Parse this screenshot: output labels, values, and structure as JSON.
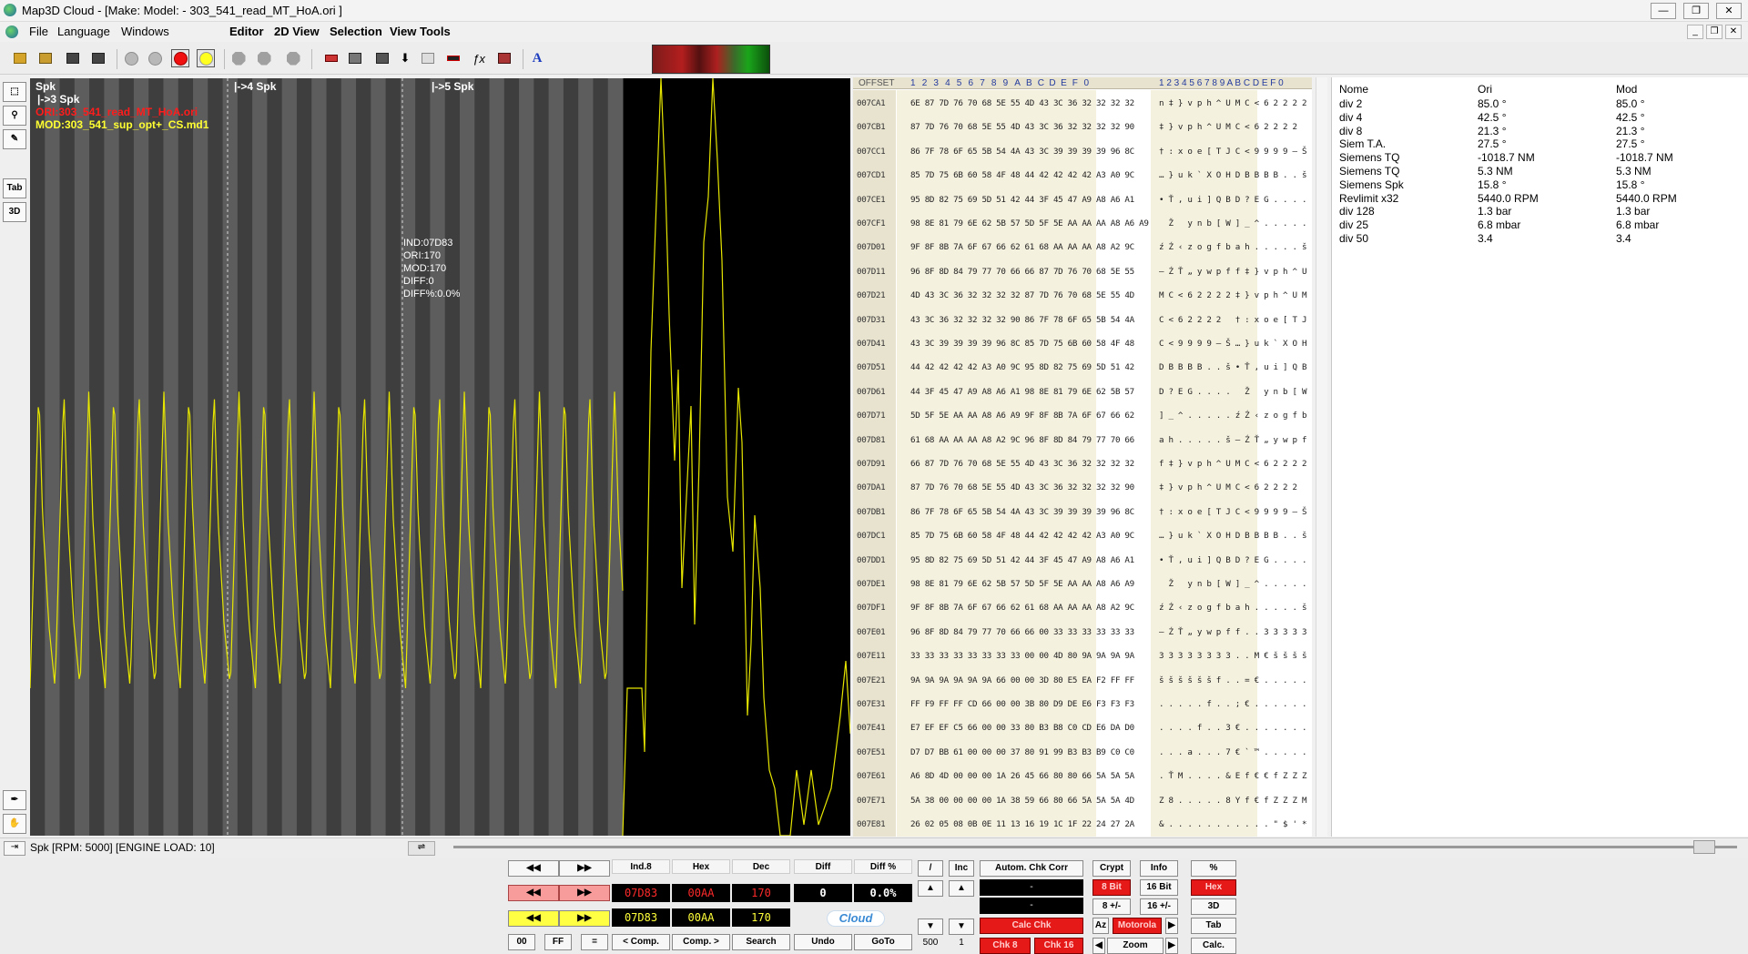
{
  "window": {
    "title": "Map3D Cloud - [Make:  Model:   - 303_541_read_MT_HoA.ori ]",
    "min_label": "—",
    "max_label": "❐",
    "close_label": "✕"
  },
  "menu": {
    "file": "File",
    "language": "Language",
    "windows": "Windows",
    "editor": "Editor",
    "view2d": "2D View",
    "selection": "Selection",
    "viewtools": "View Tools"
  },
  "leftbar": {
    "tab": "Tab",
    "three_d": "3D"
  },
  "graph": {
    "sections": [
      "Spk",
      "|->4 Spk",
      "|->5 Spk"
    ],
    "sub_section": "|->3 Spk",
    "ori_file": "ORI:303_541_read_MT_HoA.ori",
    "mod_file": "MOD:303_541_sup_opt+_CS.md1",
    "tooltip": [
      "IND:07D83",
      "ORI:170",
      "MOD:170",
      "DIFF:0",
      "DIFF%:0.0%"
    ]
  },
  "hex": {
    "offset_label": "OFFSET",
    "col_heads": [
      "1",
      "2",
      "3",
      "4",
      "5",
      "6",
      "7",
      "8",
      "9",
      "A",
      "B",
      "C",
      "D",
      "E",
      "F",
      "0"
    ],
    "ascii_head": "1 2 3 4 5 6 7 8 9 A B C D E F 0",
    "rows": [
      {
        "o": "007CA1",
        "h": "6E 87 7D 76 70 68 5E 55 4D 43 3C 36 32 32 32 32",
        "a": "n ‡ } v p h ^ U M C < 6 2 2 2 2"
      },
      {
        "o": "007CB1",
        "h": "87 7D 76 70 68 5E 55 4D 43 3C 36 32 32 32 32 90",
        "a": "‡ } v p h ^ U M C < 6 2 2 2 2"
      },
      {
        "o": "007CC1",
        "h": "86 7F 78 6F 65 5B 54 4A 43 3C 39 39 39 39 96 8C",
        "a": "† : x o e [ T J C < 9 9 9 9 – Š"
      },
      {
        "o": "007CD1",
        "h": "85 7D 75 6B 60 58 4F 48 44 42 42 42 42 A3 A0 9C",
        "a": "… } u k ` X O H D B B B B . . š"
      },
      {
        "o": "007CE1",
        "h": "95 8D 82 75 69 5D 51 42 44 3F 45 47 A9 A8 A6 A1",
        "a": "• Ť , u i ] Q B D ? E G . . . ."
      },
      {
        "o": "007CF1",
        "h": "98 8E 81 79 6E 62 5B 57 5D 5F 5E AA AA AA A8 A6 A9",
        "a": "  Ž   y n b [ W ] _ ^ . . . . ."
      },
      {
        "o": "007D01",
        "h": "9F 8F 8B 7A 6F 67 66 62 61 68 AA AA AA A8 A2 9C",
        "a": "ź Ź ‹ z o g f b a h . . . . . š"
      },
      {
        "o": "007D11",
        "h": "96 8F 8D 84 79 77 70 66 66 87 7D 76 70 68 5E 55",
        "a": "– Ź Ť „ y w p f f ‡ } v p h ^ U"
      },
      {
        "o": "007D21",
        "h": "4D 43 3C 36 32 32 32 32 87 7D 76 70 68 5E 55 4D",
        "a": "M C < 6 2 2 2 2 ‡ } v p h ^ U M"
      },
      {
        "o": "007D31",
        "h": "43 3C 36 32 32 32 32 90 86 7F 78 6F 65 5B 54 4A",
        "a": "C < 6 2 2 2 2   † : x o e [ T J"
      },
      {
        "o": "007D41",
        "h": "43 3C 39 39 39 39 96 8C 85 7D 75 6B 60 58 4F 48",
        "a": "C < 9 9 9 9 – Š … } u k ` X O H"
      },
      {
        "o": "007D51",
        "h": "44 42 42 42 42 A3 A0 9C 95 8D 82 75 69 5D 51 42",
        "a": "D B B B B . . š • Ť , u i ] Q B"
      },
      {
        "o": "007D61",
        "h": "44 3F 45 47 A9 A8 A6 A1 98 8E 81 79 6E 62 5B 57",
        "a": "D ? E G . . . .   Ž   y n b [ W"
      },
      {
        "o": "007D71",
        "h": "5D 5F 5E AA AA A8 A6 A9 9F 8F 8B 7A 6F 67 66 62",
        "a": "] _ ^ . . . . . ź Ź ‹ z o g f b"
      },
      {
        "o": "007D81",
        "h": "61 68 AA AA AA A8 A2 9C 96 8F 8D 84 79 77 70 66",
        "a": "a h . . . . . š – Ź Ť „ y w p f"
      },
      {
        "o": "007D91",
        "h": "66 87 7D 76 70 68 5E 55 4D 43 3C 36 32 32 32 32",
        "a": "f ‡ } v p h ^ U M C < 6 2 2 2 2"
      },
      {
        "o": "007DA1",
        "h": "87 7D 76 70 68 5E 55 4D 43 3C 36 32 32 32 32 90",
        "a": "‡ } v p h ^ U M C < 6 2 2 2 2"
      },
      {
        "o": "007DB1",
        "h": "86 7F 78 6F 65 5B 54 4A 43 3C 39 39 39 39 96 8C",
        "a": "† : x o e [ T J C < 9 9 9 9 – Š"
      },
      {
        "o": "007DC1",
        "h": "85 7D 75 6B 60 58 4F 48 44 42 42 42 42 A3 A0 9C",
        "a": "… } u k ` X O H D B B B B . . š"
      },
      {
        "o": "007DD1",
        "h": "95 8D 82 75 69 5D 51 42 44 3F 45 47 A9 A8 A6 A1",
        "a": "• Ť , u i ] Q B D ? E G . . . ."
      },
      {
        "o": "007DE1",
        "h": "98 8E 81 79 6E 62 5B 57 5D 5F 5E AA AA A8 A6 A9",
        "a": "  Ž   y n b [ W ] _ ^ . . . . ."
      },
      {
        "o": "007DF1",
        "h": "9F 8F 8B 7A 6F 67 66 62 61 68 AA AA AA A8 A2 9C",
        "a": "ź Ź ‹ z o g f b a h . . . . . š"
      },
      {
        "o": "007E01",
        "h": "96 8F 8D 84 79 77 70 66 66 00 33 33 33 33 33 33",
        "a": "– Ź Ť „ y w p f f . . 3 3 3 3 3"
      },
      {
        "o": "007E11",
        "h": "33 33 33 33 33 33 33 33 00 00 4D 80 9A 9A 9A 9A",
        "a": "3 3 3 3 3 3 3 3 . . M € š š š š"
      },
      {
        "o": "007E21",
        "h": "9A 9A 9A 9A 9A 9A 66 00 00 3D 80 E5 EA F2 FF FF",
        "a": "š š š š š š f . . = € . . . . ."
      },
      {
        "o": "007E31",
        "h": "FF F9 FF FF CD 66 00 00 3B 80 D9 DE E6 F3 F3 F3",
        "a": ". . . . . f . . ; € . . . . . ."
      },
      {
        "o": "007E41",
        "h": "E7 EF EF C5 66 00 00 33 80 B3 B8 C0 CD E6 DA D0",
        "a": ". . . . f . . 3 € . . . . . . ."
      },
      {
        "o": "007E51",
        "h": "D7 D7 BB 61 00 00 00 37 80 91 99 B3 B3 B9 C0 C0",
        "a": ". . . a . . . 7 € ` ™ . . . . ."
      },
      {
        "o": "007E61",
        "h": "A6 8D 4D 00 00 00 1A 26 45 66 80 80 66 5A 5A 5A",
        "a": ". Ť M . . . . & E f € € f Z Z Z"
      },
      {
        "o": "007E71",
        "h": "5A 38 00 00 00 00 1A 38 59 66 80 66 5A 5A 5A 4D",
        "a": "Z 8 . . . . . 8 Y f € f Z Z Z M"
      },
      {
        "o": "007E81",
        "h": "26 02 05 08 0B 0E 11 13 16 19 1C 1F 22 24 27 2A",
        "a": "& . . . . . . . . . . . \" $ ' *"
      }
    ]
  },
  "side": {
    "headers": {
      "name": "Nome",
      "ori": "Ori",
      "mod": "Mod"
    },
    "rows": [
      {
        "name": "div 2",
        "ori": "85.0 °",
        "mod": "85.0 °"
      },
      {
        "name": "div 4",
        "ori": "42.5 °",
        "mod": "42.5 °"
      },
      {
        "name": "div 8",
        "ori": "21.3 °",
        "mod": "21.3 °"
      },
      {
        "name": "Siem T.A.",
        "ori": "27.5 °",
        "mod": "27.5 °"
      },
      {
        "name": "Siemens TQ",
        "ori": "-1018.7 NM",
        "mod": "-1018.7 NM"
      },
      {
        "name": "Siemens TQ",
        "ori": "5.3 NM",
        "mod": "5.3 NM"
      },
      {
        "name": "Siemens Spk",
        "ori": "15.8 °",
        "mod": "15.8 °"
      },
      {
        "name": "Revlimit x32",
        "ori": "5440.0 RPM",
        "mod": "5440.0 RPM"
      },
      {
        "name": "div 128",
        "ori": "1.3 bar",
        "mod": "1.3 bar"
      },
      {
        "name": "div 25",
        "ori": "6.8 mbar",
        "mod": "6.8 mbar"
      },
      {
        "name": "div 50",
        "ori": "3.4",
        "mod": "3.4"
      }
    ]
  },
  "status": {
    "text": "Spk [RPM: 5000] [ENGINE LOAD: 10]"
  },
  "bottom": {
    "heads": {
      "ind": "Ind.8",
      "hex": "Hex",
      "dec": "Dec",
      "diff": "Diff",
      "diffp": "Diff %"
    },
    "red_row": {
      "ind": "07D83",
      "hex": "00AA",
      "dec": "170",
      "diff": "0",
      "diffp": "0.0%"
    },
    "yel_row": {
      "ind": "07D83",
      "hex": "00AA",
      "dec": "170"
    },
    "cloud": "Cloud",
    "btn_00": "00",
    "btn_ff": "FF",
    "btn_eq": "=",
    "btn_comp_l": "< Comp.",
    "btn_comp_r": "Comp. >",
    "btn_search": "Search",
    "btn_undo": "Undo",
    "btn_goto": "GoTo",
    "btn_div": "/",
    "btn_inc": "Inc",
    "step1": "500",
    "step2": "1",
    "btn_autom": "Autom. Chk Corr",
    "dash1": "-",
    "dash2": "-",
    "btn_calc_chk": "Calc Chk",
    "btn_chk8": "Chk 8",
    "btn_chk16": "Chk 16",
    "btn_crypt": "Crypt",
    "btn_info": "Info",
    "btn_8bit": "8 Bit",
    "btn_16bit": "16 Bit",
    "btn_8pm": "8 +/-",
    "btn_16pm": "16 +/-",
    "btn_az": "Az",
    "btn_motorola": "Motorola",
    "btn_zoom": "Zoom",
    "btn_pct": "%",
    "btn_hex": "Hex",
    "btn_3d": "3D",
    "btn_tab": "Tab",
    "btn_calc": "Calc."
  }
}
